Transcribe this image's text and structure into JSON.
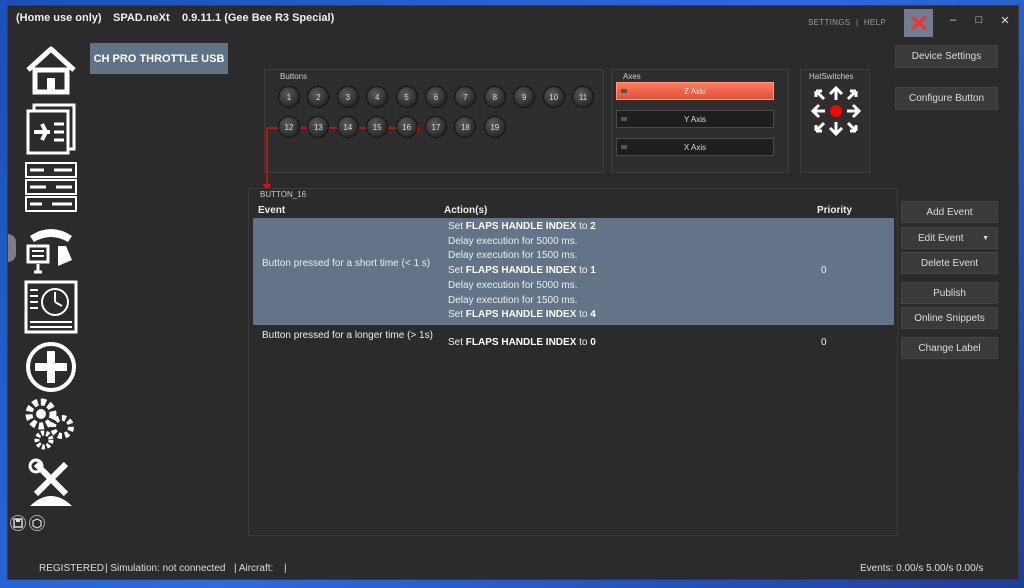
{
  "titlebar": {
    "license": "(Home use only)",
    "app_name": "SPAD.neXt",
    "version": "0.9.11.1 (Gee Bee R3 Special)",
    "settings_link": "SETTINGS",
    "separator": "|",
    "help_link": "HELP"
  },
  "device": {
    "name": "CH PRO THROTTLE USB"
  },
  "buttons_panel": {
    "label": "Buttons",
    "buttons": [
      "1",
      "2",
      "3",
      "4",
      "5",
      "6",
      "7",
      "8",
      "9",
      "10",
      "11",
      "12",
      "13",
      "14",
      "15",
      "16",
      "17",
      "18",
      "19"
    ],
    "selected": "16"
  },
  "axes_panel": {
    "label": "Axes",
    "axes": [
      {
        "label": "Z Axis",
        "active": true
      },
      {
        "label": "Y Axis",
        "active": false
      },
      {
        "label": "X Axis",
        "active": false
      }
    ]
  },
  "hat_panel": {
    "label": "HatSwitches"
  },
  "right_buttons": {
    "device_settings": "Device Settings",
    "configure_button": "Configure Button",
    "add_event": "Add Event",
    "edit_event": "Edit Event",
    "delete_event": "Delete Event",
    "publish": "Publish",
    "online_snippets": "Online Snippets",
    "change_label": "Change Label"
  },
  "event_grid": {
    "group_label": "BUTTON_16",
    "headers": {
      "event": "Event",
      "actions": "Action(s)",
      "priority": "Priority"
    },
    "rows": [
      {
        "event": "Button pressed for a short time (< 1 s)",
        "priority": "0",
        "actions": [
          {
            "pre": "Set ",
            "bold": "FLAPS HANDLE INDEX",
            "mid": " to ",
            "val": "2"
          },
          {
            "pre": "Delay execution for 5000 ms.",
            "bold": "",
            "mid": "",
            "val": ""
          },
          {
            "pre": "Delay execution for 1500 ms.",
            "bold": "",
            "mid": "",
            "val": ""
          },
          {
            "pre": "Set ",
            "bold": "FLAPS HANDLE INDEX",
            "mid": " to ",
            "val": "1"
          },
          {
            "pre": "Delay execution for 5000 ms.",
            "bold": "",
            "mid": "",
            "val": ""
          },
          {
            "pre": "Delay execution for 1500 ms.",
            "bold": "",
            "mid": "",
            "val": ""
          },
          {
            "pre": "Set ",
            "bold": "FLAPS HANDLE INDEX",
            "mid": " to ",
            "val": "4"
          }
        ]
      },
      {
        "event": "Button pressed for a longer time (> 1s)",
        "priority": "0",
        "actions": [
          {
            "pre": "Set ",
            "bold": "FLAPS HANDLE INDEX",
            "mid": " to ",
            "val": "0"
          }
        ]
      }
    ]
  },
  "statusbar": {
    "registered": "REGISTERED",
    "simulation": "| Simulation: not connected",
    "aircraft": "| Aircraft:",
    "aircraft_end": "|",
    "events": "Events: 0.00/s 5.00/s 0.00/s"
  },
  "colors": {
    "accent_selected_row": "#637489",
    "active_axis": "#e0503a",
    "close_button": "#6f7d8f",
    "indicator_red": "#ff0000"
  }
}
